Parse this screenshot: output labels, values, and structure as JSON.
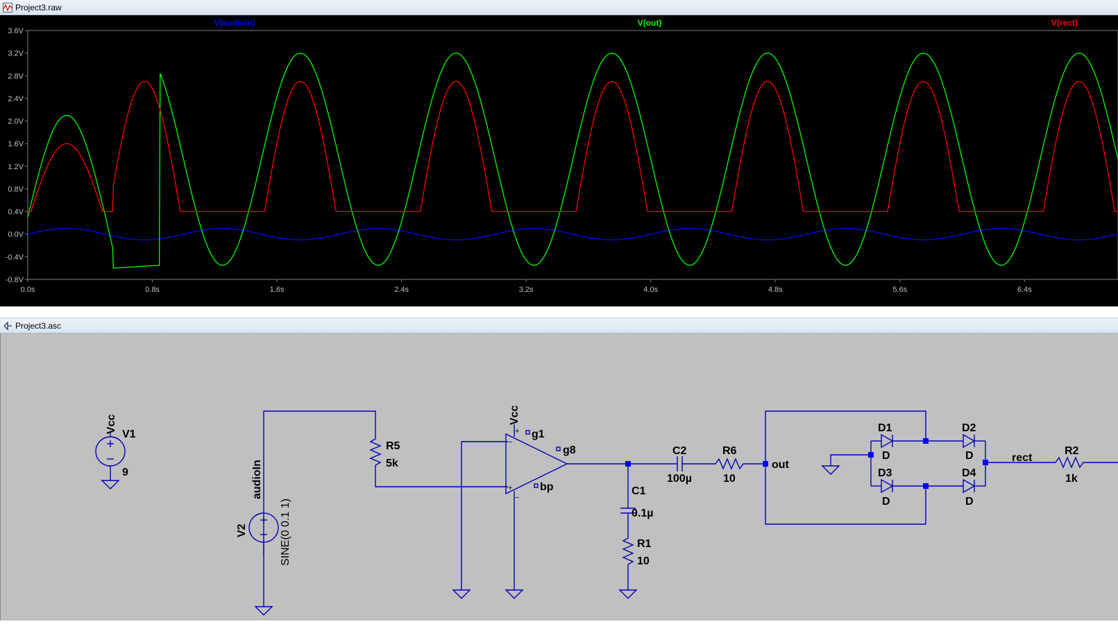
{
  "waveform_window": {
    "title": "Project3.raw",
    "traces": [
      {
        "name": "V(audioin)",
        "color": "#0000ff"
      },
      {
        "name": "V(out)",
        "color": "#00ff00"
      },
      {
        "name": "V(rect)",
        "color": "#ff0000"
      }
    ],
    "y_ticks": [
      "3.6V",
      "3.2V",
      "2.8V",
      "2.4V",
      "2.0V",
      "1.6V",
      "1.2V",
      "0.8V",
      "0.4V",
      "0.0V",
      "-0.4V",
      "-0.8V"
    ],
    "x_ticks": [
      "0.0s",
      "0.8s",
      "1.6s",
      "2.4s",
      "3.2s",
      "4.0s",
      "4.8s",
      "5.6s",
      "6.4s"
    ]
  },
  "chart_data": {
    "type": "line",
    "title": "",
    "xlabel": "",
    "ylabel": "",
    "xlim": [
      0,
      7.0
    ],
    "ylim": [
      -0.8,
      3.6
    ],
    "grid": false,
    "legend": "top",
    "series": [
      {
        "name": "V(audioin)",
        "color": "#0000ff",
        "description_x": [
          0,
          0.25,
          0.75,
          1.25,
          1.75,
          2.25,
          2.75,
          3.25,
          3.75,
          4.25,
          4.75,
          5.25,
          5.75,
          6.25,
          6.75,
          7.0
        ],
        "y": [
          0,
          0.1,
          -0.1,
          0.1,
          -0.1,
          0.1,
          -0.1,
          0.1,
          -0.1,
          0.1,
          -0.1,
          0.1,
          -0.1,
          0.1,
          -0.1,
          0
        ]
      },
      {
        "name": "V(out)",
        "color": "#00ff00",
        "x": [
          0,
          0.25,
          0.55,
          0.75,
          1.25,
          1.75,
          2.25,
          2.75,
          3.25,
          3.75,
          4.25,
          4.75,
          5.25,
          5.75,
          6.25,
          6.75,
          7.0
        ],
        "y": [
          0.3,
          2.1,
          -0.6,
          -0.55,
          3.2,
          -0.55,
          3.2,
          -0.55,
          3.2,
          -0.55,
          3.2,
          -0.55,
          3.2,
          -0.55,
          3.2,
          -0.55,
          -0.4
        ]
      },
      {
        "name": "V(rect)",
        "color": "#ff0000",
        "x": [
          0,
          0.25,
          0.5,
          1.0,
          1.25,
          1.5,
          2.0,
          2.25,
          2.5,
          3.0,
          3.25,
          3.5,
          4.0,
          4.25,
          4.5,
          5.0,
          5.25,
          5.5,
          6.0,
          6.25,
          6.5,
          7.0
        ],
        "y": [
          0.4,
          1.6,
          0.4,
          0.4,
          2.7,
          0.4,
          0.4,
          2.7,
          0.4,
          0.4,
          2.7,
          0.4,
          0.4,
          2.7,
          0.4,
          0.4,
          2.7,
          0.4,
          0.4,
          2.7,
          0.4,
          0.4
        ]
      }
    ]
  },
  "schematic_window": {
    "title": "Project3.asc",
    "labels": {
      "vcc1": "Vcc",
      "v1": "V1",
      "v1_val": "9",
      "audioin": "audioIn",
      "v2": "V2",
      "v2_val": "SINE(0 0.1 1)",
      "r5": "R5",
      "r5_val": "5k",
      "vcc2": "Vcc",
      "g1": "g1",
      "g8": "g8",
      "bp": "bp",
      "c1": "C1",
      "c1_val": "0.1µ",
      "r1": "R1",
      "r1_val": "10",
      "c2": "C2",
      "c2_val": "100µ",
      "r6": "R6",
      "r6_val": "10",
      "out": "out",
      "d1": "D1",
      "d1_val": "D",
      "d2": "D2",
      "d2_val": "D",
      "d3": "D3",
      "d3_val": "D",
      "d4": "D4",
      "d4_val": "D",
      "rect": "rect",
      "r2": "R2",
      "r2_val": "1k",
      "plus": "+",
      "minus": "−"
    }
  }
}
